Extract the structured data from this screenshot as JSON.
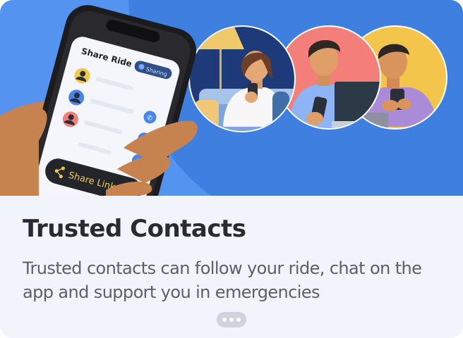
{
  "onboarding": {
    "title": "Trusted Contacts",
    "description": "Trusted contacts can follow your ride, chat on the app and support you in emergencies"
  },
  "phone_screen": {
    "header": "Share Ride",
    "badge": "Sharing",
    "share_button": "Share Link"
  },
  "colors": {
    "hero_background": "#5593f0",
    "hero_dark_arc": "#3f7fe0",
    "card_background": "#f2f4fb",
    "title_text": "#2b2b2f",
    "body_text": "#5c5f66",
    "accent_blue": "#4a86e8"
  },
  "pager": {
    "icon": "more-dots-icon"
  }
}
